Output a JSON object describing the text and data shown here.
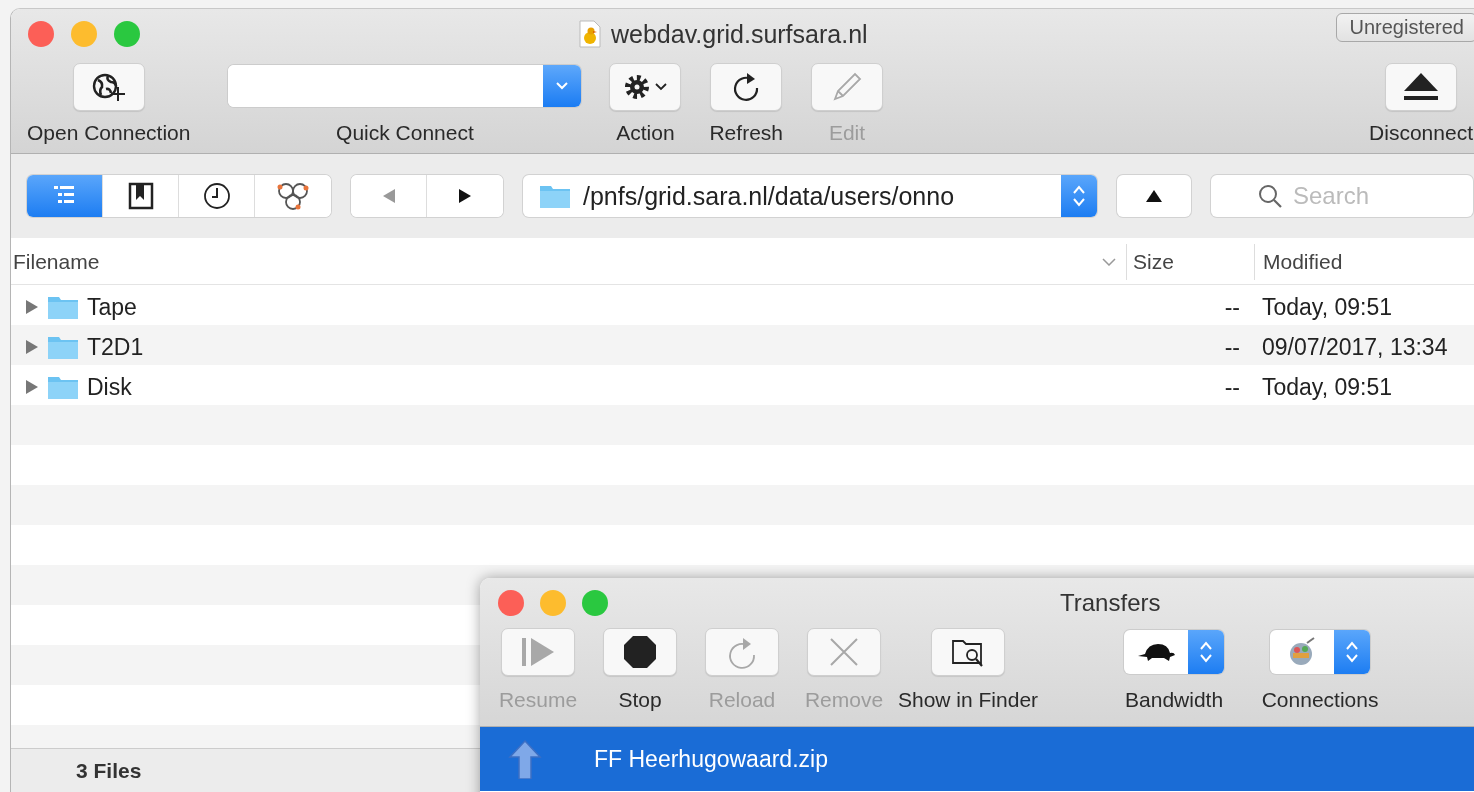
{
  "window": {
    "title": "webdav.grid.surfsara.nl",
    "badge": "Unregistered"
  },
  "toolbar": [
    {
      "kind": "button",
      "label": "Open Connection",
      "disabled": false
    },
    {
      "kind": "combo",
      "label": "Quick Connect",
      "disabled": false
    },
    {
      "kind": "menu",
      "label": "Action",
      "disabled": false
    },
    {
      "kind": "button",
      "label": "Refresh",
      "disabled": false
    },
    {
      "kind": "button",
      "label": "Edit",
      "disabled": true
    }
  ],
  "disconnect": {
    "label": "Disconnect",
    "disabled": false
  },
  "nav": {
    "view_tabs": [
      {
        "selected": true
      },
      {
        "selected": false
      },
      {
        "selected": false
      },
      {
        "selected": false
      }
    ],
    "back": {
      "disabled": true
    },
    "forward": {
      "disabled": false
    },
    "path": "/pnfs/grid.sara.nl/data/users/onno",
    "search": {
      "placeholder": "Search"
    }
  },
  "table": {
    "columns": [
      "Filename",
      "Size",
      "Modified"
    ],
    "rows": [
      {
        "name": "Tape",
        "size": "--",
        "modified": "Today, 09:51",
        "expanded": false
      },
      {
        "name": "T2D1",
        "size": "--",
        "modified": "09/07/2017, 13:34",
        "expanded": false
      },
      {
        "name": "Disk",
        "size": "--",
        "modified": "Today, 09:51",
        "expanded": false
      }
    ]
  },
  "status_bar": "3 Files",
  "transfers": {
    "title": "Transfers",
    "toolbar": [
      {
        "kind": "button",
        "label": "Resume",
        "disabled": true
      },
      {
        "kind": "button",
        "label": "Stop",
        "disabled": false
      },
      {
        "kind": "button",
        "label": "Reload",
        "disabled": true
      },
      {
        "kind": "button",
        "label": "Remove",
        "disabled": true
      },
      {
        "kind": "button",
        "label": "Show in Finder",
        "disabled": false
      },
      {
        "kind": "selector",
        "label": "Bandwidth",
        "disabled": false
      },
      {
        "kind": "selector",
        "label": "Connections",
        "disabled": false
      }
    ],
    "items": [
      {
        "name": "FF Heerhugowaard.zip",
        "selected": true
      }
    ]
  }
}
